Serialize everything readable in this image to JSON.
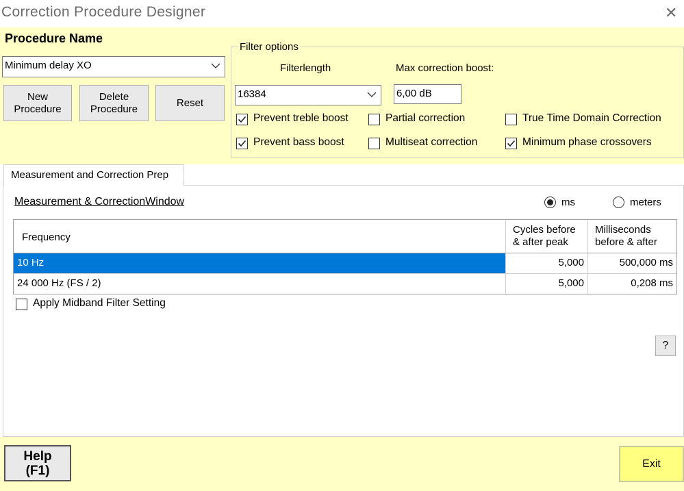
{
  "window": {
    "title": "Correction Procedure Designer",
    "close_glyph": "✕"
  },
  "procedure": {
    "label": "Procedure Name",
    "selected": "Minimum delay XO",
    "buttons": {
      "new": "New\nProcedure",
      "delete": "Delete\nProcedure",
      "reset": "Reset"
    }
  },
  "filter_options": {
    "legend": "Filter options",
    "filterlength_label": "Filterlength",
    "filterlength_value": "16384",
    "max_boost_label": "Max correction boost:",
    "max_boost_value": "6,00 dB",
    "checkboxes": [
      {
        "label": "Prevent treble boost",
        "checked": true
      },
      {
        "label": "Partial correction",
        "checked": false
      },
      {
        "label": "True Time Domain Correction",
        "checked": false
      },
      {
        "label": "Prevent bass boost",
        "checked": true
      },
      {
        "label": "Multiseat correction",
        "checked": false
      },
      {
        "label": "Minimum phase crossovers",
        "checked": true
      }
    ]
  },
  "tabs": [
    {
      "label": "Measurement and Correction Prep",
      "active": true
    }
  ],
  "measurement": {
    "section_title": "Measurement & CorrectionWindow",
    "units": [
      {
        "label": "ms",
        "selected": true
      },
      {
        "label": "meters",
        "selected": false
      }
    ],
    "table": {
      "headers": [
        "Frequency",
        "Cycles before\n& after peak",
        "Milliseconds\nbefore & after"
      ],
      "rows": [
        {
          "frequency": "10 Hz",
          "cycles": "5,000",
          "ms": "500,000 ms",
          "selected": true
        },
        {
          "frequency": "24 000 Hz (FS / 2)",
          "cycles": "5,000",
          "ms": "0,208 ms",
          "selected": false
        }
      ]
    },
    "midband_label": "Apply Midband Filter Setting",
    "midband_checked": false,
    "help_small": "?"
  },
  "footer": {
    "help": "Help\n(F1)",
    "exit": "Exit"
  },
  "colors": {
    "panel_bg": "#ffffc6",
    "selection": "#0078d7",
    "exit_bg": "#ffff80"
  }
}
